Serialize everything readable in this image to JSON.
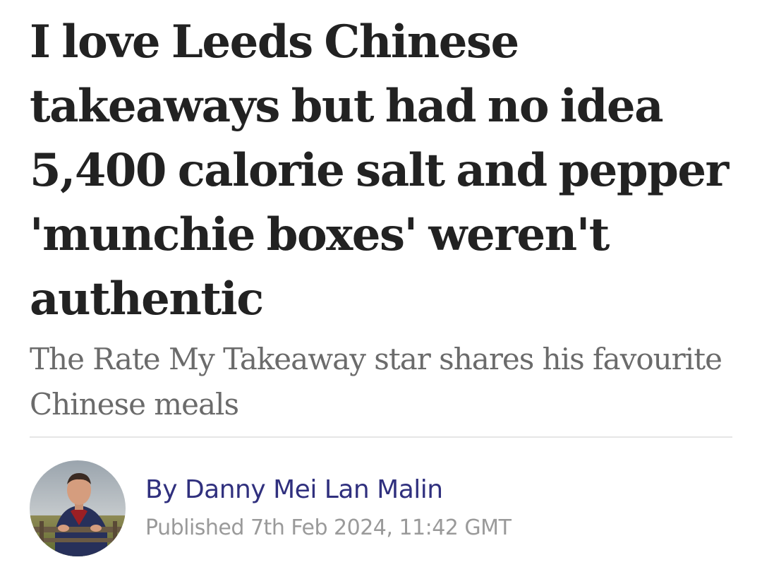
{
  "article": {
    "headline": "I love Leeds Chinese takeaways but had no idea 5,400 calorie salt and pepper 'munchie boxes' weren't authentic",
    "subheadline": "The Rate My Takeaway star shares his favourite Chinese meals"
  },
  "byline": {
    "author": "By Danny Mei Lan Malin",
    "published": "Published 7th Feb 2024, 11:42 GMT"
  },
  "colors": {
    "headline": "#222222",
    "subheadline": "#6b6b6b",
    "author_link": "#30307e",
    "timestamp": "#9a9a9a",
    "divider": "#e6e6e6"
  }
}
